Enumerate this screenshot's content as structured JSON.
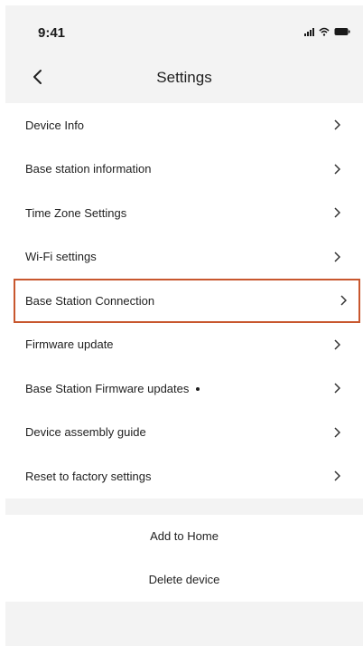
{
  "status_bar": {
    "time": "9:41",
    "icons": [
      "cellular-signal-icon",
      "wifi-icon",
      "battery-icon"
    ]
  },
  "nav": {
    "title": "Settings",
    "back_icon": "chevron-left-icon"
  },
  "settings": {
    "items": [
      {
        "label": "Device Info"
      },
      {
        "label": "Base station information"
      },
      {
        "label": "Time Zone Settings"
      },
      {
        "label": "Wi-Fi settings"
      },
      {
        "label": "Base Station Connection"
      },
      {
        "label": "Firmware update"
      },
      {
        "label": "Base Station Firmware updates"
      },
      {
        "label": "Device assembly guide"
      },
      {
        "label": "Reset to factory settings"
      }
    ],
    "chevron_icon": "chevron-right-icon"
  },
  "actions": {
    "add_to_home": "Add to Home",
    "delete_device": "Delete device"
  },
  "colors": {
    "background": "#f3f3f3",
    "surface": "#ffffff",
    "highlight_border": "#c8572e",
    "text": "#1f1f1f"
  }
}
